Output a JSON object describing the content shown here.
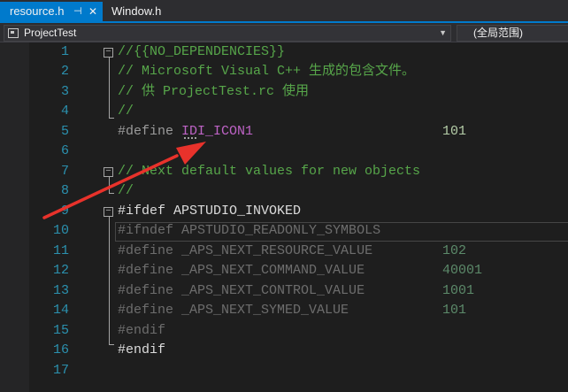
{
  "tabs": [
    {
      "label": "resource.h",
      "active": true,
      "pin_icon": "pin-icon",
      "close_icon": "close-icon"
    },
    {
      "label": "Window.h",
      "active": false
    }
  ],
  "navbar": {
    "project": "ProjectTest",
    "scope": "(全局范围)"
  },
  "editor": {
    "lines": [
      {
        "num": "1",
        "text": "//{{NO_DEPENDENCIES}}"
      },
      {
        "num": "2",
        "text": "// Microsoft Visual C++ 生成的包含文件。"
      },
      {
        "num": "3",
        "text": "// 供 ProjectTest.rc 使用"
      },
      {
        "num": "4",
        "text": "//"
      },
      {
        "num": "5",
        "directive": "#define",
        "name": "IDI_ICON1",
        "value": "101"
      },
      {
        "num": "6",
        "text": ""
      },
      {
        "num": "7",
        "text": "// Next default values for new objects"
      },
      {
        "num": "8",
        "text": "//"
      },
      {
        "num": "9",
        "directive": "#ifdef",
        "name": "APSTUDIO_INVOKED"
      },
      {
        "num": "10",
        "directive": "#ifndef",
        "name": "APSTUDIO_READONLY_SYMBOLS"
      },
      {
        "num": "11",
        "directive": "#define",
        "name": "_APS_NEXT_RESOURCE_VALUE",
        "value": "102"
      },
      {
        "num": "12",
        "directive": "#define",
        "name": "_APS_NEXT_COMMAND_VALUE",
        "value": "40001"
      },
      {
        "num": "13",
        "directive": "#define",
        "name": "_APS_NEXT_CONTROL_VALUE",
        "value": "1001"
      },
      {
        "num": "14",
        "directive": "#define",
        "name": "_APS_NEXT_SYMED_VALUE",
        "value": "101"
      },
      {
        "num": "15",
        "directive": "#endif"
      },
      {
        "num": "16",
        "directive": "#endif"
      },
      {
        "num": "17",
        "text": ""
      }
    ]
  },
  "colors": {
    "accent": "#007acc",
    "line_number": "#2b91af",
    "comment": "#57a64a",
    "macro": "#bd63c5",
    "number": "#b5cea8",
    "annotation_arrow": "#e8322b"
  }
}
